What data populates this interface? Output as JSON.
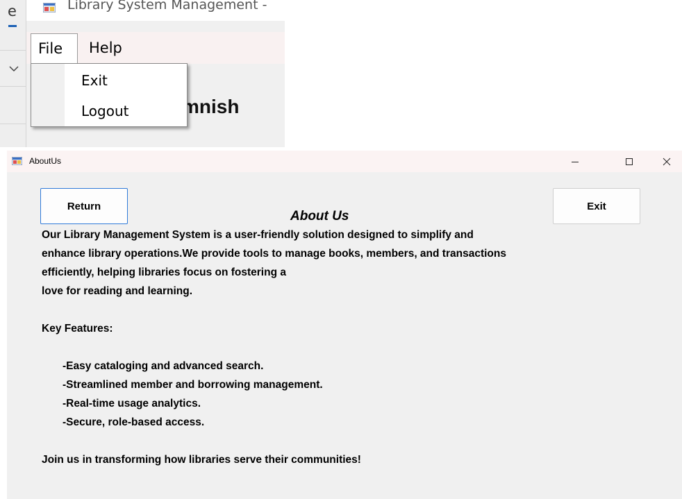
{
  "background_window": {
    "partial_tab_letter": "e",
    "app_title": "Library System Management -",
    "menu": {
      "file": "File",
      "help": "Help"
    },
    "file_menu_items": [
      "Exit",
      "Logout"
    ],
    "partial_body_text": "mnish"
  },
  "about_window": {
    "title": "AboutUs",
    "controls": {
      "minimize": "—",
      "maximize": "☐",
      "close": "✕"
    },
    "return_button": "Return",
    "exit_button": "Exit",
    "heading": "About Us",
    "description_lines": [
      "Our Library Management System is a user-friendly solution designed to simplify and",
      "enhance library operations.We provide tools to manage books, members, and transactions",
      "efficiently, helping libraries focus on fostering a",
      "love for reading and learning."
    ],
    "features_title": "Key Features:",
    "features": [
      "-Easy cataloging and advanced search.",
      "-Streamlined member and borrowing management.",
      "-Real-time usage analytics.",
      "-Secure, role-based access."
    ],
    "closing": "Join us in transforming how libraries serve their communities!"
  },
  "colors": {
    "accent_border": "#2f7ad8",
    "titlebar": "#fbf3f3",
    "window_bg": "#f0f0f0"
  }
}
